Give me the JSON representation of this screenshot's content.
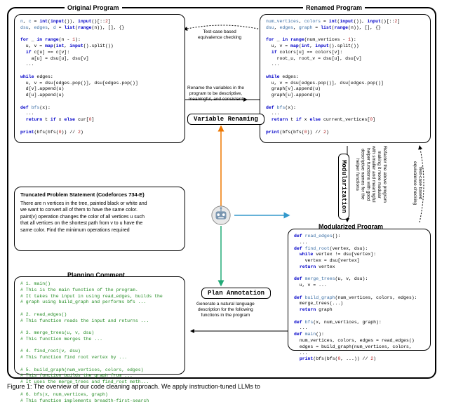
{
  "titles": {
    "original": "Original Program",
    "renamed": "Renamed Program",
    "problem": "Truncated Problem Statement (Codeforces 734-E)",
    "planning": "Planning Comment",
    "modularized": "Modularized Program"
  },
  "pills": {
    "var_rename": "Variable Renaming",
    "plan_anno": "Plan Annotation",
    "modular": "Modularization"
  },
  "smalltext": {
    "testcase1": "Test-case based\nequivalence checking",
    "rename_desc": "Rename the variables in the\nprogram to be descriptive,\nmeaningful, and consistent",
    "modular_desc": "Refactor the above program\nmaking it more modular\nwith smaller and meaningful\nhelper functions with good\ndescriptive names for the\nhelper functions",
    "testcase2": "Test-case based\nequivalence checking",
    "plan_desc": "Generate a natural language\ndescription for the following\nfunctions in the program"
  },
  "problem_text": "There are n vertices in the tree, painted black or white and\nwe want to convert all of them to have the same color.\npaint(v) operation changes the color of all vertices u such\nthat all vertices on the shortest path from v to u have the\nsame color. Find the minimum operations required",
  "caption": "Figure 1:  The overview of our code cleaning approach.  We apply instruction-tuned LLMs to"
}
